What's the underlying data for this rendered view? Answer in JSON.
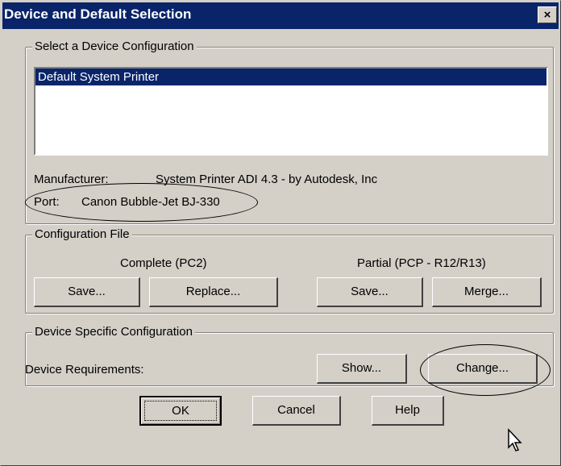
{
  "window": {
    "title": "Device and Default Selection",
    "close_glyph": "×"
  },
  "device_group": {
    "legend": "Select a Device Configuration",
    "list_items": [
      "Default System Printer"
    ],
    "manufacturer_label": "Manufacturer:",
    "manufacturer_value": "System Printer ADI 4.3 - by Autodesk, Inc",
    "port_label": "Port:",
    "port_value": "Canon Bubble-Jet BJ-330"
  },
  "config_file_group": {
    "legend": "Configuration File",
    "complete_label": "Complete (PC2)",
    "partial_label": "Partial (PCP - R12/R13)",
    "save1_label": "Save...",
    "replace_label": "Replace...",
    "save2_label": "Save...",
    "merge_label": "Merge..."
  },
  "device_specific_group": {
    "legend": "Device Specific Configuration",
    "requirements_label": "Device Requirements:",
    "show_label": "Show...",
    "change_label": "Change..."
  },
  "footer": {
    "ok_label": "OK",
    "cancel_label": "Cancel",
    "help_label": "Help"
  },
  "colors": {
    "title_bar": "#0a246a",
    "selection": "#0a246a",
    "face": "#d4d0c8"
  }
}
